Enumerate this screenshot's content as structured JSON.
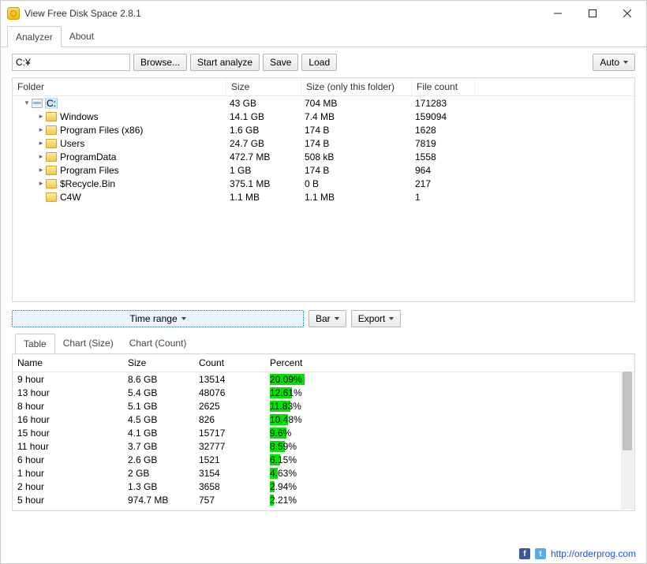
{
  "window": {
    "title": "View Free Disk Space 2.8.1"
  },
  "main_tabs": [
    "Analyzer",
    "About"
  ],
  "main_tab_active": 0,
  "toolbar": {
    "path_value": "C:¥",
    "browse": "Browse...",
    "start": "Start analyze",
    "save": "Save",
    "load": "Load",
    "auto": "Auto"
  },
  "tree": {
    "columns": {
      "folder": "Folder",
      "size": "Size",
      "size_only": "Size (only this folder)",
      "file_count": "File count"
    },
    "rows": [
      {
        "indent": 0,
        "expander": "▾",
        "icon": "drive",
        "name": "C:",
        "size": "43 GB",
        "size_only": "704 MB",
        "count": "171283",
        "selected": true
      },
      {
        "indent": 1,
        "expander": "▸",
        "icon": "folder",
        "name": "Windows",
        "size": "14.1 GB",
        "size_only": "7.4 MB",
        "count": "159094"
      },
      {
        "indent": 1,
        "expander": "▸",
        "icon": "folder",
        "name": "Program Files (x86)",
        "size": "1.6 GB",
        "size_only": "174 B",
        "count": "1628"
      },
      {
        "indent": 1,
        "expander": "▸",
        "icon": "folder",
        "name": "Users",
        "size": "24.7 GB",
        "size_only": "174 B",
        "count": "7819"
      },
      {
        "indent": 1,
        "expander": "▸",
        "icon": "folder",
        "name": "ProgramData",
        "size": "472.7 MB",
        "size_only": "508 kB",
        "count": "1558"
      },
      {
        "indent": 1,
        "expander": "▸",
        "icon": "folder",
        "name": "Program Files",
        "size": "1 GB",
        "size_only": "174 B",
        "count": "964"
      },
      {
        "indent": 1,
        "expander": "▸",
        "icon": "folder",
        "name": "$Recycle.Bin",
        "size": "375.1 MB",
        "size_only": "0 B",
        "count": "217"
      },
      {
        "indent": 1,
        "expander": "",
        "icon": "folder",
        "name": "C4W",
        "size": "1.1 MB",
        "size_only": "1.1 MB",
        "count": "1"
      }
    ]
  },
  "lower_toolbar": {
    "time_range": "Time range",
    "bar": "Bar",
    "export": "Export"
  },
  "lower_tabs": [
    "Table",
    "Chart (Size)",
    "Chart (Count)"
  ],
  "lower_tab_active": 0,
  "table": {
    "columns": {
      "name": "Name",
      "size": "Size",
      "count": "Count",
      "percent": "Percent"
    },
    "rows": [
      {
        "name": "9 hour",
        "size": "8.6 GB",
        "count": "13514",
        "percent": "20.09%",
        "pct_val": 20.09
      },
      {
        "name": "13 hour",
        "size": "5.4 GB",
        "count": "48076",
        "percent": "12.61%",
        "pct_val": 12.61
      },
      {
        "name": "8 hour",
        "size": "5.1 GB",
        "count": "2625",
        "percent": "11.83%",
        "pct_val": 11.83
      },
      {
        "name": "16 hour",
        "size": "4.5 GB",
        "count": "826",
        "percent": "10.48%",
        "pct_val": 10.48
      },
      {
        "name": "15 hour",
        "size": "4.1 GB",
        "count": "15717",
        "percent": "9.6%",
        "pct_val": 9.6
      },
      {
        "name": "11 hour",
        "size": "3.7 GB",
        "count": "32777",
        "percent": "8.59%",
        "pct_val": 8.59
      },
      {
        "name": "6 hour",
        "size": "2.6 GB",
        "count": "1521",
        "percent": "6.15%",
        "pct_val": 6.15
      },
      {
        "name": "1 hour",
        "size": "2 GB",
        "count": "3154",
        "percent": "4.63%",
        "pct_val": 4.63
      },
      {
        "name": "2 hour",
        "size": "1.3 GB",
        "count": "3658",
        "percent": "2.94%",
        "pct_val": 2.94
      },
      {
        "name": "5 hour",
        "size": "974.7 MB",
        "count": "757",
        "percent": "2.21%",
        "pct_val": 2.21
      }
    ]
  },
  "footer": {
    "url": "http://orderprog.com"
  }
}
